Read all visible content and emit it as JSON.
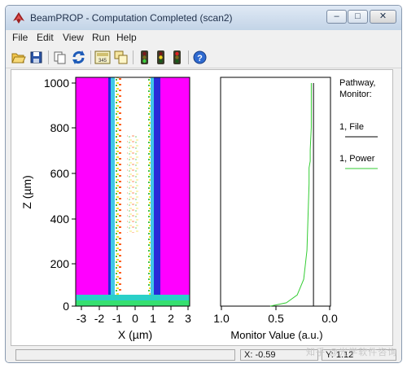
{
  "window": {
    "title": "BeamPROP - Computation Completed (scan2)"
  },
  "window_controls": {
    "minimize": "–",
    "maximize": "□",
    "close": "✕"
  },
  "menu": [
    "File",
    "Edit",
    "View",
    "Run",
    "Help"
  ],
  "toolbar": {
    "icons": [
      "open-folder-icon",
      "save-icon",
      "copy-icon",
      "refresh-icon",
      "calculator-icon",
      "windows-icon",
      "traffic-light-icon",
      "traffic-light-icon",
      "traffic-light-icon",
      "help-icon"
    ],
    "calc_label": "345"
  },
  "colors": {
    "field_background": "#ff00ff",
    "power_line": "#33cc33",
    "file_line": "#000000"
  },
  "left_plot": {
    "y_label": "Z (µm)",
    "x_label": "X (µm)",
    "y_ticks": [
      "1000",
      "800",
      "600",
      "400",
      "200",
      "0"
    ],
    "x_ticks": [
      "-3",
      "-2",
      "-1",
      "0",
      "1",
      "2",
      "3"
    ]
  },
  "right_plot": {
    "x_label": "Monitor Value (a.u.)",
    "x_ticks": [
      "1.0",
      "0.5",
      "0.0"
    ],
    "legend": {
      "header_line1": "Pathway,",
      "header_line2": "Monitor:",
      "entry1": "1, File",
      "entry2": "1, Power"
    }
  },
  "chart_data": {
    "type": "line",
    "x_axis": "Monitor Value (a.u.)",
    "xlim": [
      1.0,
      0.0
    ],
    "ylim": [
      0,
      1000
    ],
    "series": [
      {
        "name": "1, File",
        "x": [
          0.15,
          0.15
        ],
        "y": [
          0,
          1000
        ]
      },
      {
        "name": "1, Power",
        "x": [
          0.55,
          0.4,
          0.3,
          0.24,
          0.21,
          0.2,
          0.19,
          0.19,
          0.18,
          0.18,
          0.17,
          0.17,
          0.17
        ],
        "y": [
          0,
          15,
          50,
          120,
          250,
          400,
          550,
          620,
          650,
          700,
          800,
          900,
          1000
        ]
      }
    ]
  },
  "status": {
    "field1": "",
    "x_readout": "X: -0.59",
    "field3": "Y: 1.12"
  },
  "watermark": "知乎 @光学软件咨询"
}
